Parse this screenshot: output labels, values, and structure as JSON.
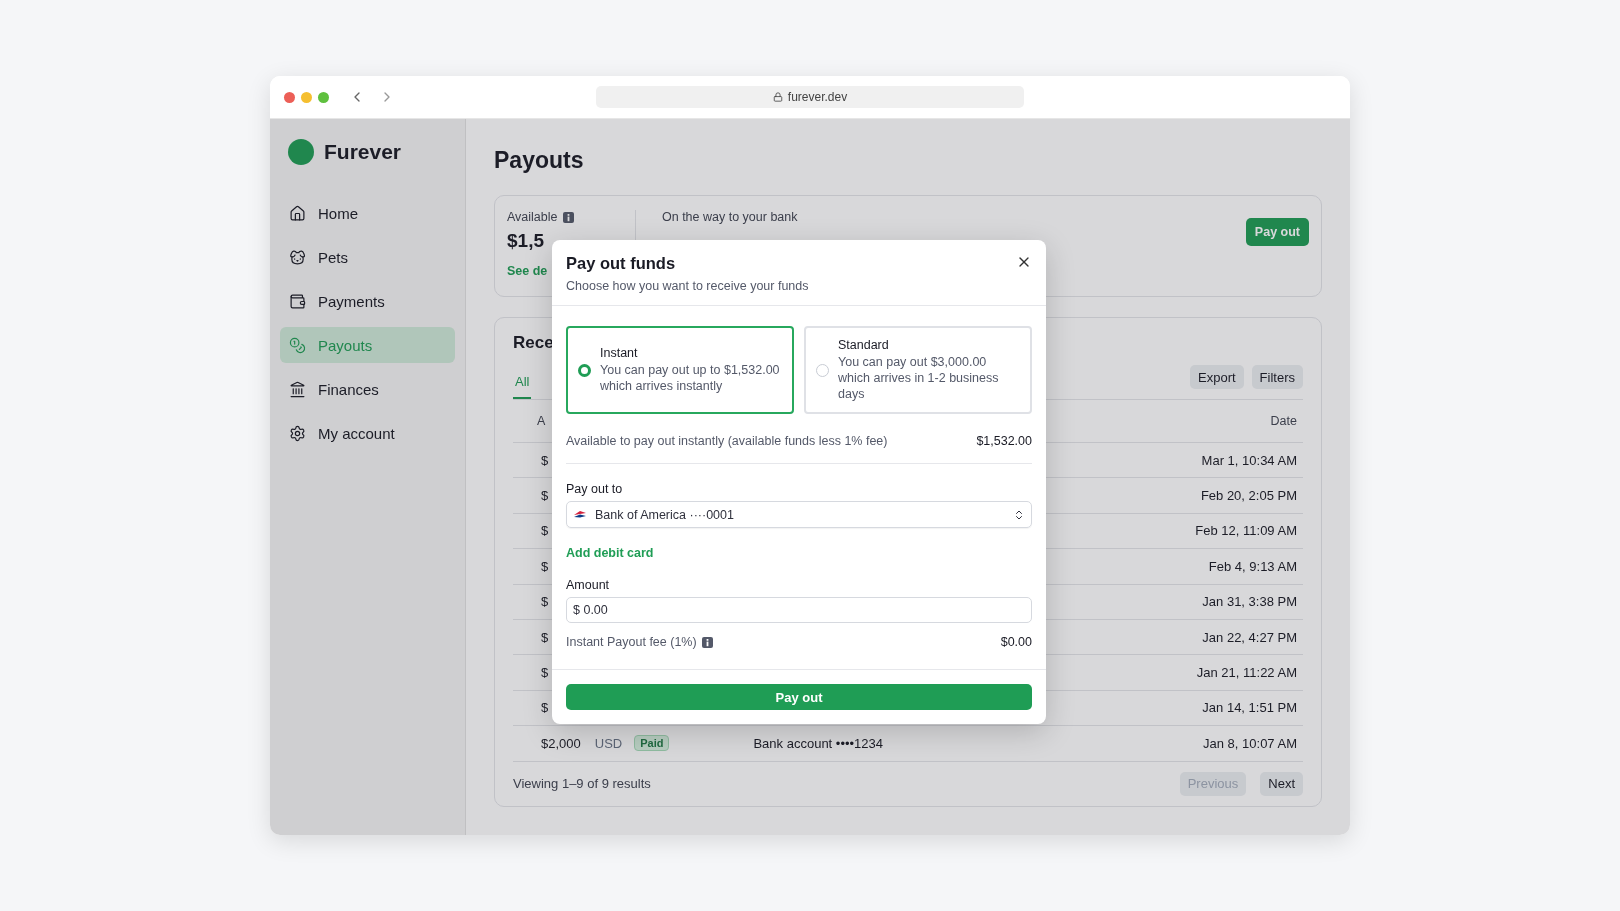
{
  "browser": {
    "url": "furever.dev"
  },
  "sidebar": {
    "brand": "Furever",
    "items": [
      {
        "label": "Home",
        "selected": false
      },
      {
        "label": "Pets",
        "selected": false
      },
      {
        "label": "Payments",
        "selected": false
      },
      {
        "label": "Payouts",
        "selected": true
      },
      {
        "label": "Finances",
        "selected": false
      },
      {
        "label": "My account",
        "selected": false
      }
    ]
  },
  "page": {
    "title": "Payouts"
  },
  "balances": {
    "available_label": "Available",
    "available_amount": "$1,5",
    "details_link": "See de",
    "in_transit_label": "On the way to your bank",
    "payout_button": "Pay out"
  },
  "recent": {
    "title": "Rece",
    "tabs": [
      {
        "label": "All",
        "selected": true
      }
    ],
    "export_button": "Export",
    "filters_button": "Filters",
    "columns": [
      "A",
      "Date"
    ],
    "rows": [
      {
        "amount": "$",
        "date": "Mar 1, 10:34 AM"
      },
      {
        "amount": "$",
        "date": "Feb 20, 2:05 PM"
      },
      {
        "amount": "$",
        "date": "Feb 12, 11:09 AM"
      },
      {
        "amount": "$",
        "date": "Feb 4, 9:13 AM"
      },
      {
        "amount": "$",
        "date": "Jan 31, 3:38 PM"
      },
      {
        "amount": "$",
        "date": "Jan 22, 4:27 PM"
      },
      {
        "amount": "$",
        "date": "Jan 21, 11:22 AM"
      },
      {
        "amount": "$",
        "date": "Jan 14, 1:51 PM"
      },
      {
        "amount": "$2,000",
        "currency": "USD",
        "status": "Paid",
        "destination": "Bank account ••••1234",
        "date": "Jan 8, 10:07 AM"
      }
    ],
    "footer": "Viewing 1–9 of 9 results",
    "previous": {
      "label": "Previous",
      "disabled": true
    },
    "next": {
      "label": "Next",
      "disabled": false
    }
  },
  "modal": {
    "title": "Pay out funds",
    "subtitle": "Choose how you want to receive your funds",
    "options": [
      {
        "title": "Instant",
        "description": "You can pay out up to $1,532.00 which arrives instantly",
        "selected": true
      },
      {
        "title": "Standard",
        "description": "You can pay out $3,000.00 which arrives in 1-2 business days",
        "selected": false
      }
    ],
    "available_text": "Available to pay out instantly (available funds less 1% fee)",
    "available_value": "$1,532.00",
    "payout_to_label": "Pay out to",
    "payout_to_value": "Bank of America ····0001",
    "add_card_link": "Add debit card",
    "amount_label": "Amount",
    "amount_value": "$ 0.00",
    "fee_label": "Instant Payout fee (1%)",
    "fee_value": "$0.00",
    "submit_button": "Pay out"
  }
}
